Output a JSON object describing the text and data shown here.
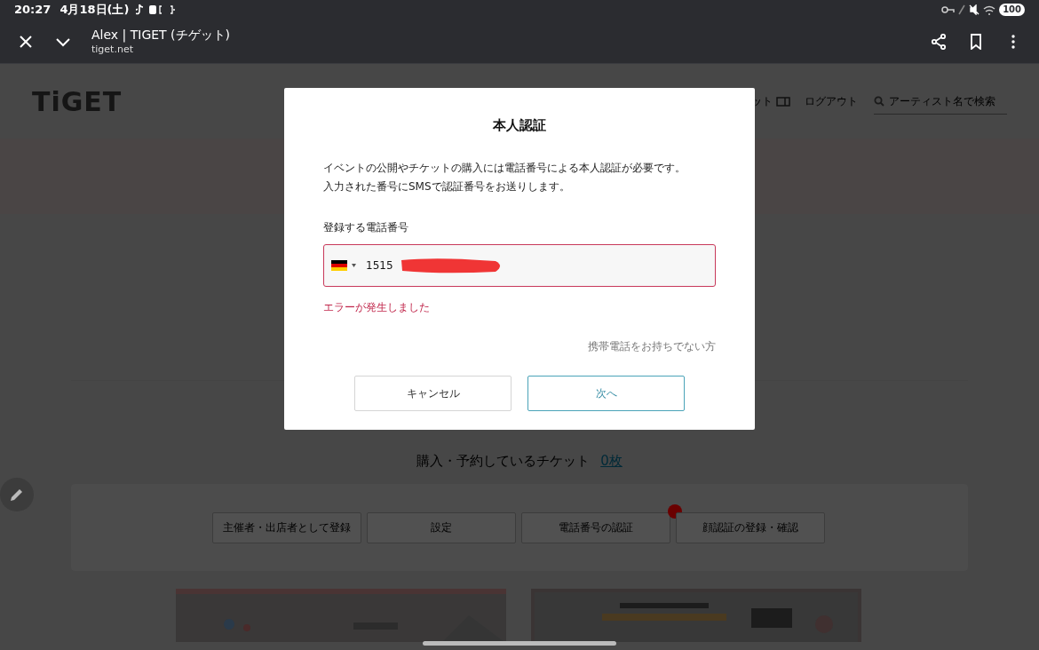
{
  "status_bar": {
    "time": "20:27",
    "date": "4月18日(土)",
    "battery": "100"
  },
  "browser": {
    "title": "Alex | TIGET (チゲット)",
    "url": "tiget.net"
  },
  "page": {
    "logo": "TiGET",
    "nav": [
      {
        "label": "ット",
        "kind": "ticket"
      },
      {
        "label": "ログアウト",
        "kind": "plain"
      }
    ],
    "search": {
      "placeholder": "アーティスト名で検索"
    },
    "tickets": {
      "label": "購入・予約しているチケット",
      "count": "0枚"
    },
    "actions": [
      {
        "label": "主催者・出店者として登録",
        "alert": false
      },
      {
        "label": "設定",
        "alert": false
      },
      {
        "label": "電話番号の認証",
        "alert": true
      },
      {
        "label": "顔認証の登録・確認",
        "alert": false
      }
    ]
  },
  "dialog": {
    "title": "本人認証",
    "message": [
      "イベントの公開やチケットの購入には電話番号による本人認証が必要です。",
      "入力された番号にSMSで認証番号をお送りします。"
    ],
    "field_label": "登録する電話番号",
    "phone": {
      "value": "1515",
      "error": true
    },
    "error": "エラーが発生しました",
    "no_phone_link": "携帯電話をお持ちでない方",
    "buttons": [
      {
        "label": "キャンセル",
        "kind": "secondary"
      },
      {
        "label": "次へ",
        "kind": "primary"
      }
    ]
  }
}
